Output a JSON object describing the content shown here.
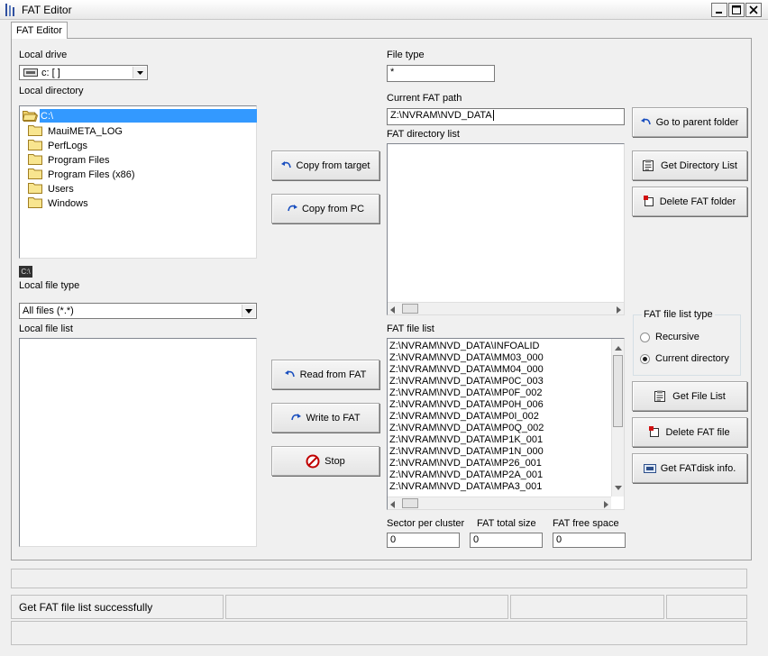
{
  "window": {
    "title": "FAT Editor"
  },
  "tab": {
    "label": "FAT Editor"
  },
  "local": {
    "drive_label": "Local drive",
    "drive_value": "c: [ ]",
    "directory_label": "Local directory",
    "directories": [
      "C:\\",
      "MauiMETA_LOG",
      "PerfLogs",
      "Program Files",
      "Program Files (x86)",
      "Users",
      "Windows"
    ],
    "current_path_indicator": "C:\\",
    "file_type_label": "Local file type",
    "file_type_value": "All files (*.*)",
    "file_list_label": "Local file list"
  },
  "transfer": {
    "copy_from_target": "Copy from target",
    "copy_from_pc": "Copy from PC",
    "read_from_fat": "Read from FAT",
    "write_to_fat": "Write to FAT",
    "stop": "Stop"
  },
  "fat": {
    "file_type_label": "File type",
    "file_type_value": "*",
    "current_path_label": "Current FAT path",
    "current_path_value": "Z:\\NVRAM\\NVD_DATA",
    "directory_list_label": "FAT directory list",
    "file_list_label": "FAT file list",
    "files": [
      "Z:\\NVRAM\\NVD_DATA\\INFOALID",
      "Z:\\NVRAM\\NVD_DATA\\MM03_000",
      "Z:\\NVRAM\\NVD_DATA\\MM04_000",
      "Z:\\NVRAM\\NVD_DATA\\MP0C_003",
      "Z:\\NVRAM\\NVD_DATA\\MP0F_002",
      "Z:\\NVRAM\\NVD_DATA\\MP0H_006",
      "Z:\\NVRAM\\NVD_DATA\\MP0I_002",
      "Z:\\NVRAM\\NVD_DATA\\MP0Q_002",
      "Z:\\NVRAM\\NVD_DATA\\MP1K_001",
      "Z:\\NVRAM\\NVD_DATA\\MP1N_000",
      "Z:\\NVRAM\\NVD_DATA\\MP26_001",
      "Z:\\NVRAM\\NVD_DATA\\MP2A_001",
      "Z:\\NVRAM\\NVD_DATA\\MPA3_001"
    ],
    "sector_per_cluster_label": "Sector per cluster",
    "sector_per_cluster_value": "0",
    "total_size_label": "FAT total size",
    "total_size_value": "0",
    "free_space_label": "FAT free space",
    "free_space_value": "0"
  },
  "actions": {
    "go_to_parent": "Go to parent folder",
    "get_directory_list": "Get Directory List",
    "delete_fat_folder": "Delete FAT folder",
    "get_file_list": "Get File List",
    "delete_fat_file": "Delete FAT file",
    "get_fat_disk_info": "Get FATdisk info."
  },
  "list_type": {
    "title": "FAT file list type",
    "recursive": "Recursive",
    "current_directory": "Current directory",
    "selected": "current_directory"
  },
  "status": {
    "message": "Get FAT file list successfully"
  },
  "colors": {
    "selection": "#3399ff",
    "window_bg": "#f0f0f0"
  }
}
